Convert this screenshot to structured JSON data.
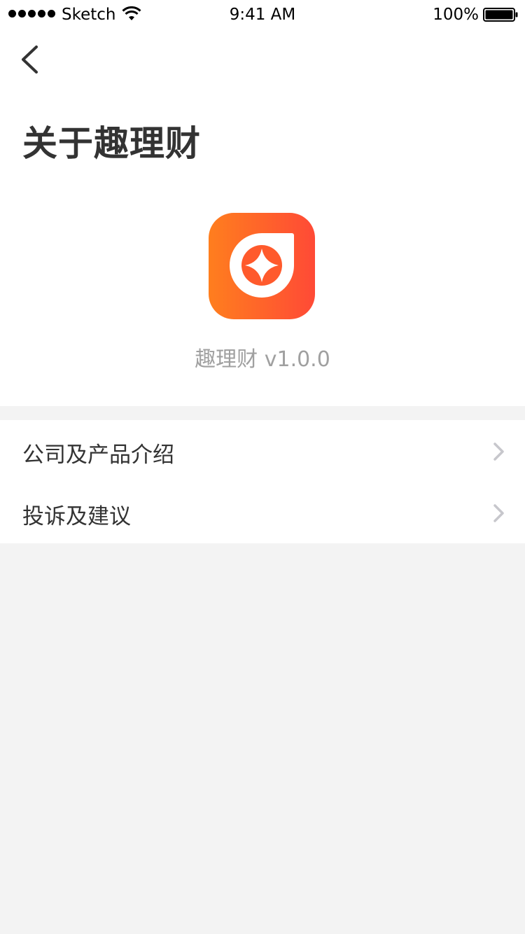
{
  "status_bar": {
    "carrier": "Sketch",
    "time": "9:41 AM",
    "battery_percent": "100%",
    "signal_icon": "signal-dots-icon",
    "wifi_icon": "wifi-icon",
    "battery_icon": "battery-full-icon"
  },
  "nav": {
    "back_icon": "chevron-left-icon"
  },
  "page": {
    "title": "关于趣理财"
  },
  "app": {
    "icon": "app-logo-icon",
    "version_text": "趣理财 v1.0.0",
    "icon_gradient": [
      "#ff7e1e",
      "#ff4a36"
    ]
  },
  "menu": {
    "items": [
      {
        "label": "公司及产品介绍",
        "icon": "chevron-right-icon"
      },
      {
        "label": "投诉及建议",
        "icon": "chevron-right-icon"
      }
    ]
  },
  "colors": {
    "background": "#f3f3f3",
    "surface": "#ffffff",
    "text_primary": "#333333",
    "text_secondary": "#a0a0a0",
    "chevron": "#c7c7cc"
  }
}
